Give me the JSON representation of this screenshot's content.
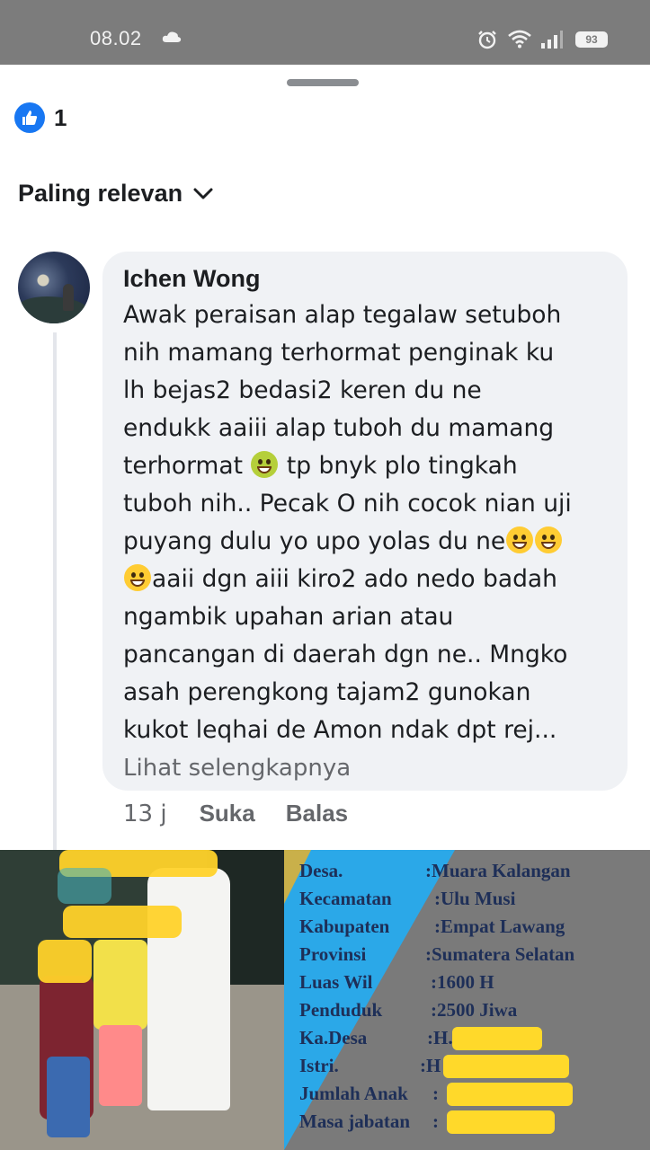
{
  "status_bar": {
    "time": "08.02",
    "battery": "93"
  },
  "reactions": {
    "count": "1"
  },
  "sort": {
    "label": "Paling relevan"
  },
  "comment": {
    "author": "Ichen Wong",
    "lines": [
      "Awak peraisan alap tegalaw setuboh",
      "nih mamang terhormat penginak ku",
      "lh bejas2 bedasi2 keren du ne",
      "endukk aaiii alap tuboh du mamang",
      "terhormat",
      "tp bnyk plo tingkah",
      "tuboh nih.. Pecak O nih cocok nian uji",
      "puyang dulu yo upo yolas du ne",
      "aaii dgn aiii kiro2 ado nedo badah",
      "ngambik upahan arian atau",
      "pancangan di daerah dgn ne.. Mngko",
      "asah perengkong tajam2 gunokan",
      "kukot leqhai de Amon ndak dpt rej..."
    ],
    "see_more": "Lihat selengkapnya",
    "time_ago": "13 j",
    "like_label": "Suka",
    "reply_label": "Balas"
  },
  "post_image": {
    "rows": [
      {
        "key": "Desa.",
        "value": ":Muara Kalangan"
      },
      {
        "key": "Kecamatan",
        "value": ":Ulu Musi"
      },
      {
        "key": "Kabupaten",
        "value": ":Empat Lawang"
      },
      {
        "key": "Provinsi",
        "value": ":Sumatera Selatan"
      },
      {
        "key": "Luas Wil",
        "value": ":1600 H"
      },
      {
        "key": "Penduduk",
        "value": ":2500 Jiwa"
      },
      {
        "key": "Ka.Desa",
        "value": ":H."
      },
      {
        "key": "Istri.",
        "value": ":H"
      },
      {
        "key": "Jumlah Anak",
        "value": ":"
      },
      {
        "key": "Masa jabatan",
        "value": ":"
      }
    ]
  }
}
